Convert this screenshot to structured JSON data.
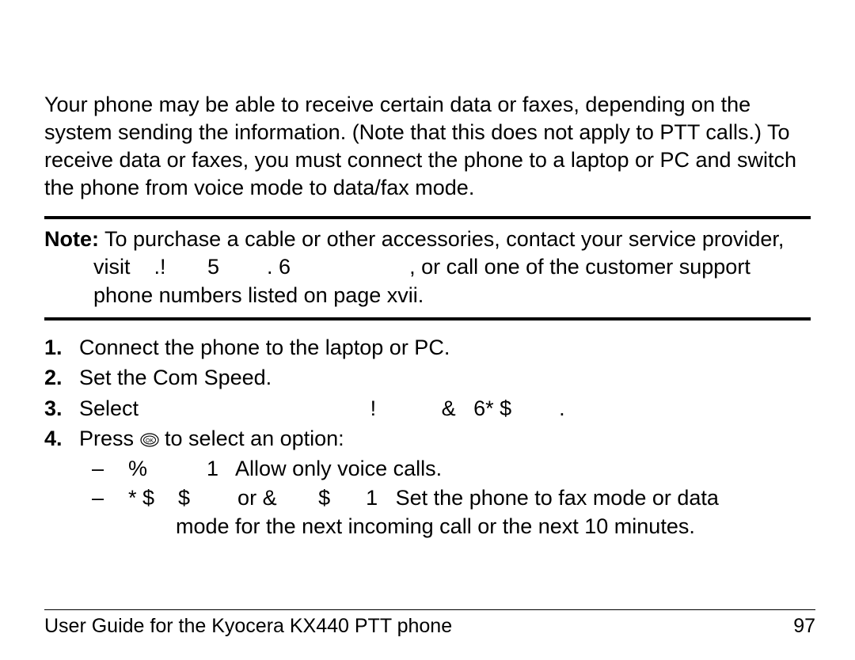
{
  "intro": "Your phone may be able to receive certain data or faxes, depending on the system sending the information. (Note that this does not apply to PTT calls.) To receive data or faxes, you must connect the phone to a laptop or PC and switch the phone from voice mode to data/fax mode.",
  "note": {
    "label": "Note:",
    "line1": " To purchase a cable or other accessories, contact your service provider,",
    "line2": "visit    .!       5        . 6                    , or call one of the customer support",
    "line3": "phone numbers listed on page xvii."
  },
  "steps": [
    {
      "num": "1.",
      "text": "Connect the phone to the laptop or PC."
    },
    {
      "num": "2.",
      "text": "Set the Com Speed."
    },
    {
      "num": "3.",
      "text": "Select                                       !           &   6* $        ."
    },
    {
      "num": "4.",
      "pre": "Press ",
      "post": " to select an option:",
      "subitems": [
        {
          "dash": "–",
          "text": "%          1   Allow only voice calls."
        },
        {
          "dash": "–",
          "text": "* $    $        or &       $      1   Set the phone to fax mode or data",
          "wrap": "mode for the next incoming call or the next 10 minutes."
        }
      ]
    }
  ],
  "footer": {
    "title": "User Guide for the Kyocera KX440 PTT phone",
    "page": "97"
  }
}
